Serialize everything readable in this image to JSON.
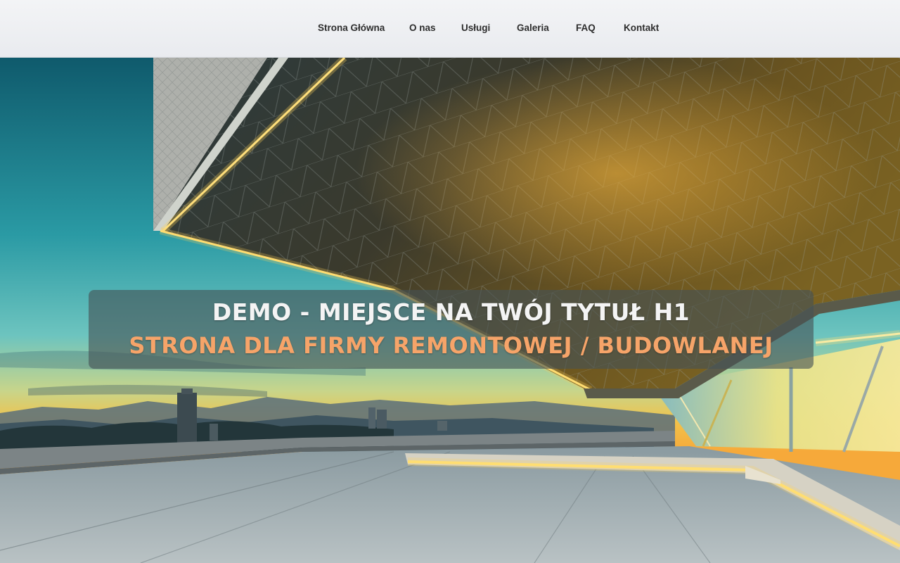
{
  "nav": {
    "items": [
      {
        "label": "Strona Główna"
      },
      {
        "label": "O nas"
      },
      {
        "label": "Usługi"
      },
      {
        "label": "Galeria"
      },
      {
        "label": "FAQ"
      },
      {
        "label": "Kontakt"
      }
    ]
  },
  "hero": {
    "title_line1": "DEMO - MIEJSCE NA TWÓJ TYTUŁ H1",
    "title_line2": "STRONA DLA FIRMY REMONTOWEJ / BUDOWLANEJ",
    "image_subject": "modern-architecture-canopy-at-sunset",
    "colors": {
      "subtitle": "#f6a469",
      "title": "#f4f4f4",
      "sky_top": "#1d6b7a",
      "sky_horizon": "#f2c24a",
      "led_glow": "#ffd85a"
    }
  }
}
